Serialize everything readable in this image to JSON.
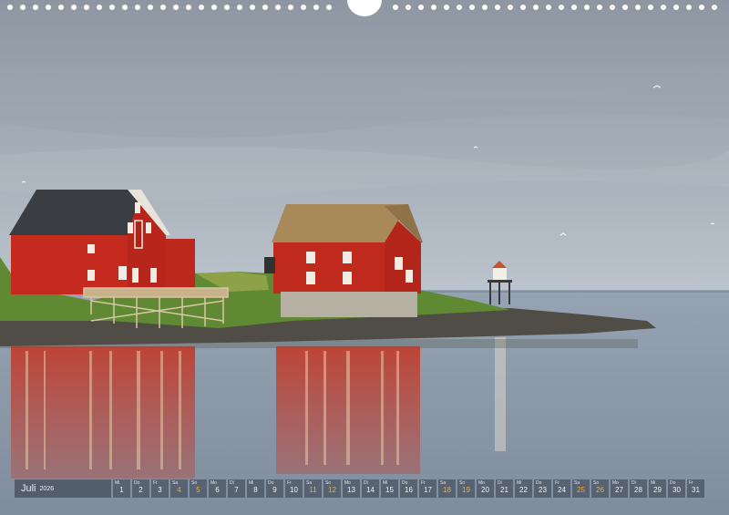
{
  "colors": {
    "sky_top": "#8e97a2",
    "sky_horizon": "#b9c2cb",
    "sea": "#8a98a8",
    "barn_red": "#c0271d",
    "roof_dark": "#3b3e42",
    "roof_thatch": "#a58a5b",
    "grass": "#5f8c34",
    "hole": "#ffffff",
    "weekday": "#f1f3f6",
    "weekend": "#e6b04a"
  },
  "calendar": {
    "month": "Juli",
    "year": "2026",
    "days": [
      {
        "wd": "Mi",
        "n": "1",
        "weekend": false
      },
      {
        "wd": "Do",
        "n": "2",
        "weekend": false
      },
      {
        "wd": "Fr",
        "n": "3",
        "weekend": false
      },
      {
        "wd": "Sa",
        "n": "4",
        "weekend": true
      },
      {
        "wd": "So",
        "n": "5",
        "weekend": true
      },
      {
        "wd": "Mo",
        "n": "6",
        "weekend": false
      },
      {
        "wd": "Di",
        "n": "7",
        "weekend": false
      },
      {
        "wd": "Mi",
        "n": "8",
        "weekend": false
      },
      {
        "wd": "Do",
        "n": "9",
        "weekend": false
      },
      {
        "wd": "Fr",
        "n": "10",
        "weekend": false
      },
      {
        "wd": "Sa",
        "n": "11",
        "weekend": true
      },
      {
        "wd": "So",
        "n": "12",
        "weekend": true
      },
      {
        "wd": "Mo",
        "n": "13",
        "weekend": false
      },
      {
        "wd": "Di",
        "n": "14",
        "weekend": false
      },
      {
        "wd": "Mi",
        "n": "15",
        "weekend": false
      },
      {
        "wd": "Do",
        "n": "16",
        "weekend": false
      },
      {
        "wd": "Fr",
        "n": "17",
        "weekend": false
      },
      {
        "wd": "Sa",
        "n": "18",
        "weekend": true
      },
      {
        "wd": "So",
        "n": "19",
        "weekend": true
      },
      {
        "wd": "Mo",
        "n": "20",
        "weekend": false
      },
      {
        "wd": "Di",
        "n": "21",
        "weekend": false
      },
      {
        "wd": "Mi",
        "n": "22",
        "weekend": false
      },
      {
        "wd": "Do",
        "n": "23",
        "weekend": false
      },
      {
        "wd": "Fr",
        "n": "24",
        "weekend": false
      },
      {
        "wd": "Sa",
        "n": "25",
        "weekend": true
      },
      {
        "wd": "So",
        "n": "26",
        "weekend": true
      },
      {
        "wd": "Mo",
        "n": "27",
        "weekend": false
      },
      {
        "wd": "Di",
        "n": "28",
        "weekend": false
      },
      {
        "wd": "Mi",
        "n": "29",
        "weekend": false
      },
      {
        "wd": "Do",
        "n": "30",
        "weekend": false
      },
      {
        "wd": "Fr",
        "n": "31",
        "weekend": false
      }
    ]
  }
}
